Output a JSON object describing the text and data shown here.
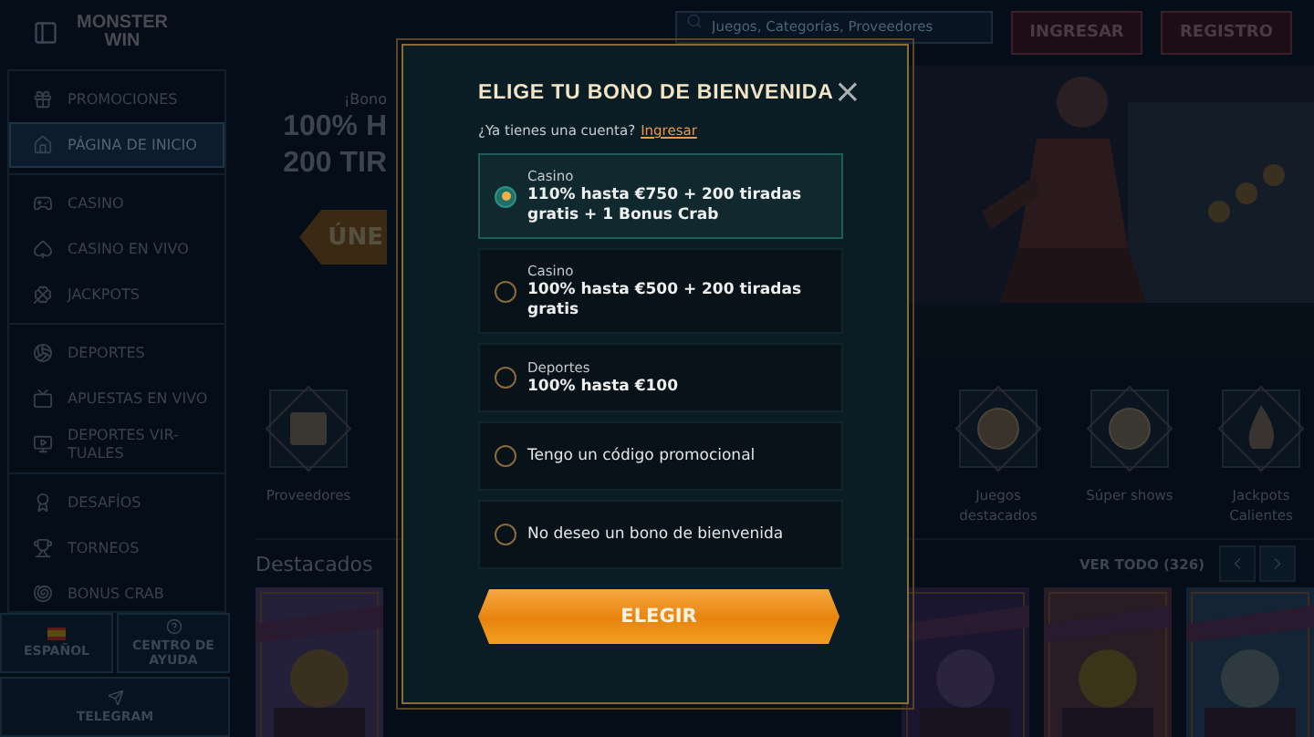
{
  "header": {
    "logo": "MONSTER WIN",
    "search": {
      "placeholder": "Juegos, Categorías, Proveedores"
    },
    "buttons": [
      "INGRESAR",
      "REGISTRO"
    ]
  },
  "sidebar": {
    "groups": [
      [
        {
          "label": "PROMOCIONES",
          "selected": false
        },
        {
          "label": "PÁGINA DE INICIO",
          "selected": true
        }
      ],
      [
        {
          "label": "CASINO",
          "selected": false
        },
        {
          "label": "CASINO EN VIVO",
          "selected": false
        },
        {
          "label": "JACKPOTS",
          "selected": false
        }
      ],
      [
        {
          "label": "DEPORTES",
          "selected": false
        },
        {
          "label": "APUESTAS EN VIVO",
          "selected": false
        },
        {
          "label": "DEPORTES VIR-TUALES",
          "selected": false
        }
      ],
      [
        {
          "label": "DESAFÍOS",
          "selected": false
        },
        {
          "label": "TORNEOS",
          "selected": false
        },
        {
          "label": "BONUS CRAB",
          "selected": false
        }
      ]
    ],
    "footer": [
      "ESPAÑOL",
      "CENTRO DE AYUDA",
      "TELEGRAM"
    ]
  },
  "hero": {
    "kicker": "¡Bono",
    "headline": [
      "100% H",
      "200 TIR"
    ],
    "button": "ÚNE"
  },
  "categories": [
    {
      "label": "Proveedores"
    },
    {
      "label": "Juegos destacados"
    },
    {
      "label": "Súper shows"
    },
    {
      "label": "Jackpots Calientes"
    }
  ],
  "featured": {
    "title": "Destacados",
    "view_all": "VER TODO (326)"
  },
  "modal": {
    "title": "ELIGE TU BONO DE BIENVENIDA",
    "close": "×",
    "account_prompt": "¿Ya tienes una cuenta?",
    "login_link": "Ingresar",
    "options": [
      {
        "category": "Casino",
        "text": "110% hasta €750 + 200 tiradas gratis + 1 Bonus Crab",
        "selected": true
      },
      {
        "category": "Casino",
        "text": "100% hasta €500 + 200 tiradas gratis",
        "selected": false
      },
      {
        "category": "Deportes",
        "text": "100% hasta €100",
        "selected": false
      },
      {
        "text": "Tengo un código promocional",
        "selected": false
      },
      {
        "text": "No deseo un bono de bienvenida",
        "selected": false
      }
    ],
    "button": "ELEGIR"
  }
}
